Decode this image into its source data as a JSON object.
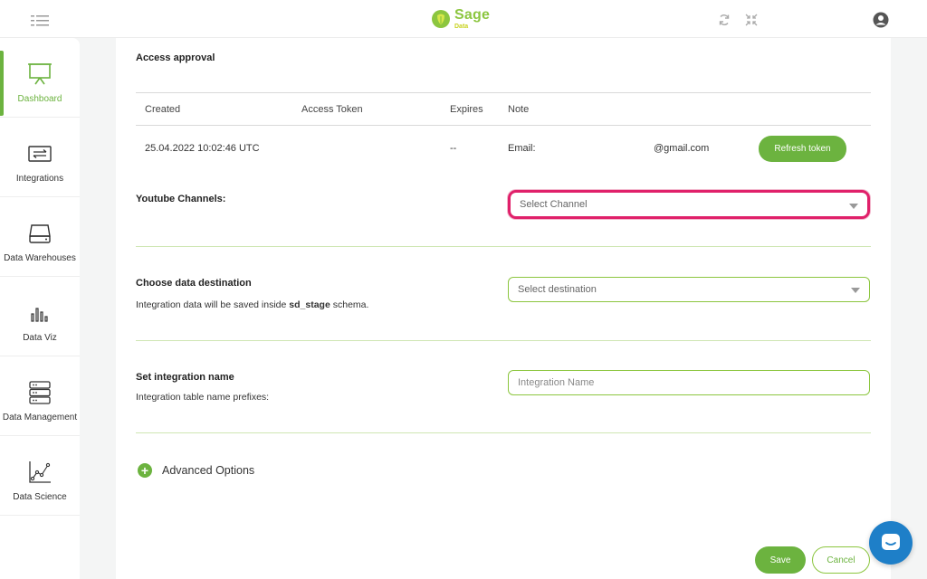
{
  "header": {
    "logo_name": "Sage",
    "logo_sub": "Data",
    "icons": [
      "menu-toggle-icon",
      "refresh-icon",
      "collapse-icon",
      "account-icon"
    ]
  },
  "sidebar": {
    "items": [
      {
        "label": "Dashboard",
        "icon": "presentation-board-icon",
        "active": true
      },
      {
        "label": "Integrations",
        "icon": "transfer-arrows-icon",
        "active": false
      },
      {
        "label": "Data Warehouses",
        "icon": "hard-drive-icon",
        "active": false
      },
      {
        "label": "Data Viz",
        "icon": "bar-chart-icon",
        "active": false
      },
      {
        "label": "Data Management",
        "icon": "server-stack-icon",
        "active": false
      },
      {
        "label": "Data Science",
        "icon": "scatter-line-icon",
        "active": false
      }
    ]
  },
  "access": {
    "title": "Access approval",
    "columns": [
      "Created",
      "Access Token",
      "Expires",
      "Note"
    ],
    "row": {
      "created": "25.04.2022 10:02:46 UTC",
      "access_token": "",
      "expires": "--",
      "note_label": "Email:",
      "note_value": "@gmail.com"
    },
    "refresh_label": "Refresh token"
  },
  "youtube": {
    "label": "Youtube Channels:",
    "placeholder": "Select Channel"
  },
  "destination": {
    "title": "Choose data destination",
    "desc_prefix": "Integration data will be saved inside ",
    "desc_schema": "sd_stage",
    "desc_suffix": " schema.",
    "placeholder": "Select destination"
  },
  "integration": {
    "title": "Set integration name",
    "desc": "Integration table name prefixes:",
    "placeholder": "Integration Name"
  },
  "advanced": {
    "label": "Advanced Options"
  },
  "actions": {
    "save": "Save",
    "cancel": "Cancel"
  },
  "colors": {
    "accent": "#6cb33f",
    "highlight": "#e0206a",
    "chat": "#1e7fc8"
  }
}
